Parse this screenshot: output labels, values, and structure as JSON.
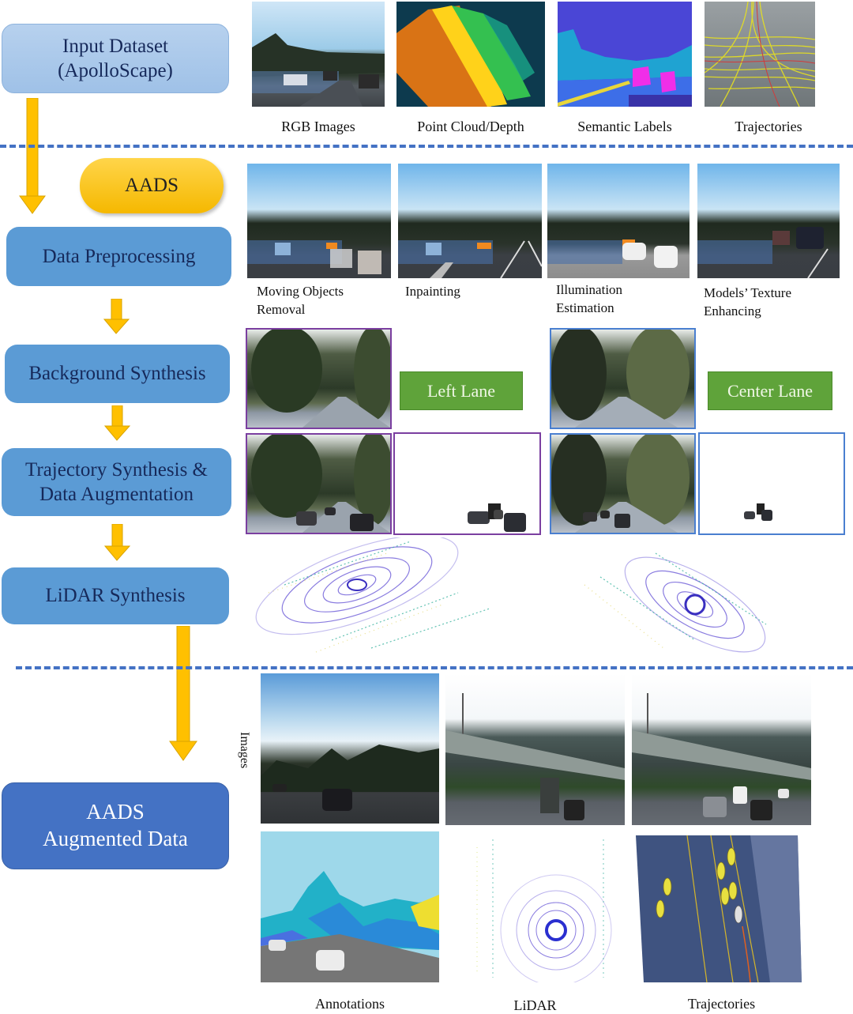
{
  "pipeline": {
    "input": {
      "line1": "Input Dataset",
      "line2": "(ApolloScape)"
    },
    "aads_pill": "AADS",
    "steps": [
      {
        "label": "Data Preprocessing"
      },
      {
        "label": "Background Synthesis"
      },
      {
        "line1": "Trajectory Synthesis &",
        "line2": "Data Augmentation"
      },
      {
        "label": "LiDAR Synthesis"
      }
    ],
    "output": {
      "line1": "AADS",
      "line2": "Augmented Data"
    }
  },
  "input_row": {
    "captions": [
      "RGB Images",
      "Point Cloud/Depth",
      "Semantic Labels",
      "Trajectories"
    ]
  },
  "preprocessing_row": {
    "captions": [
      {
        "line1": "Moving Objects",
        "line2": "Removal"
      },
      {
        "line1": "Inpainting",
        "line2": ""
      },
      {
        "line1": "Illumination",
        "line2": "Estimation"
      },
      {
        "line1": "Models’ Texture",
        "line2": "Enhancing"
      }
    ]
  },
  "lanes": {
    "left": "Left Lane",
    "center": "Center Lane"
  },
  "output_section": {
    "row_label": "Images",
    "captions": [
      "Annotations",
      "LiDAR",
      "Trajectories"
    ]
  },
  "colors": {
    "arrow": "#ffc000",
    "dash": "#4472c4",
    "step_box": "#5b9bd5",
    "output_box": "#4472c4",
    "lane_box": "#5fa33a",
    "left_lane_border": "#7b3fa0",
    "center_lane_border": "#4a7fd0"
  }
}
